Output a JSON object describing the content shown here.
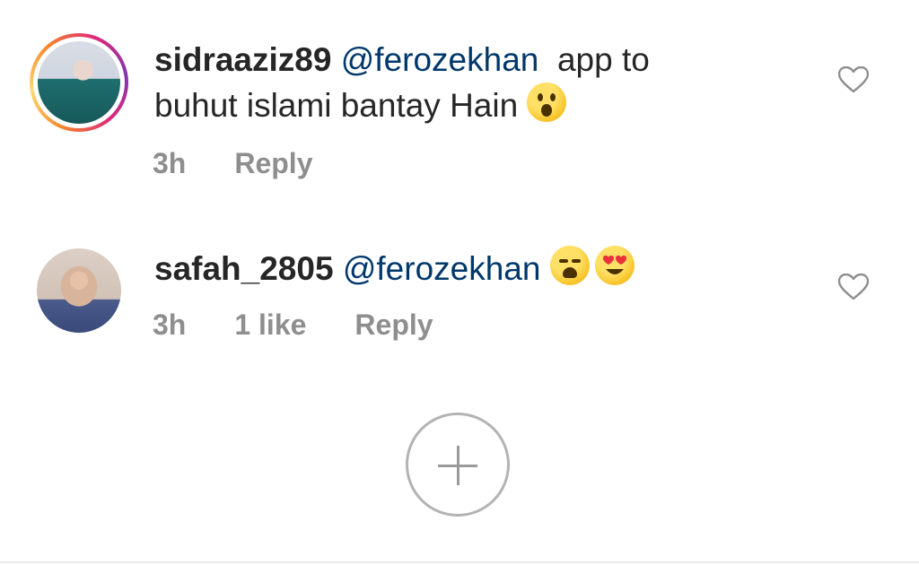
{
  "comments": [
    {
      "username": "sidraaziz89",
      "mention": "@ferozekhan",
      "text_line1": "app to",
      "text_line2": "buhut islami bantay Hain",
      "emoji": "hushed-face",
      "time": "3h",
      "likes": "",
      "reply_label": "Reply",
      "has_story_ring": true
    },
    {
      "username": "safah_2805",
      "mention": "@ferozekhan",
      "text_line1": "",
      "emojis": [
        "weary-face",
        "smiling-face-with-heart-eyes"
      ],
      "time": "3h",
      "likes": "1 like",
      "reply_label": "Reply",
      "has_story_ring": false
    }
  ],
  "icons": {
    "like": "heart-outline-icon",
    "add": "plus-circle-icon"
  },
  "colors": {
    "text": "#262626",
    "mention": "#00376b",
    "meta": "#8e8e8e"
  }
}
